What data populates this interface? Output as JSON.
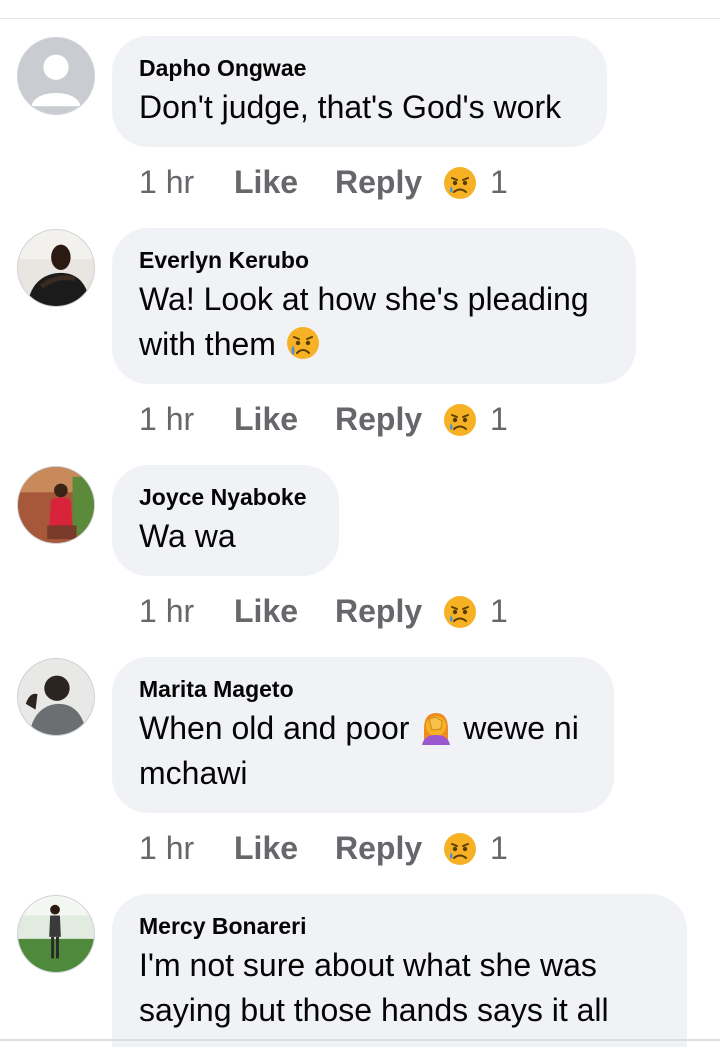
{
  "comments": [
    {
      "author": "Dapho Ongwae",
      "text": "Don't judge, that's God's work",
      "text_tail": "",
      "time": "1 hr",
      "like_label": "Like",
      "reply_label": "Reply",
      "reaction_icon": "sad-face-reaction-icon",
      "reaction_count": "1",
      "avatar": "default-avatar"
    },
    {
      "author": "Everlyn Kerubo",
      "text": "Wa! Look at how she's pleading with them",
      "text_tail": "",
      "inline_emoji": "crying-face-emoji",
      "time": "1 hr",
      "like_label": "Like",
      "reply_label": "Reply",
      "reaction_icon": "sad-face-reaction-icon",
      "reaction_count": "1",
      "avatar": "photo-avatar"
    },
    {
      "author": "Joyce Nyaboke",
      "text": "Wa wa",
      "text_tail": "",
      "time": "1 hr",
      "like_label": "Like",
      "reply_label": "Reply",
      "reaction_icon": "sad-face-reaction-icon",
      "reaction_count": "1",
      "avatar": "photo-avatar"
    },
    {
      "author": "Marita Mageto",
      "text": "When old and poor",
      "inline_emoji": "woman-facepalming-emoji",
      "text_tail": "wewe ni mchawi",
      "time": "1 hr",
      "like_label": "Like",
      "reply_label": "Reply",
      "reaction_icon": "sad-face-reaction-icon",
      "reaction_count": "1",
      "avatar": "photo-avatar"
    },
    {
      "author": "Mercy Bonareri",
      "text": "I'm not sure about what she was saying but those hands says it all",
      "text_tail": "",
      "avatar": "photo-avatar"
    }
  ],
  "colors": {
    "bubble": "#f0f2f5",
    "meta_text": "#65676b",
    "name_text": "#050505",
    "reaction_yellow": "#f7b125",
    "tear_blue": "#4a90e2"
  }
}
